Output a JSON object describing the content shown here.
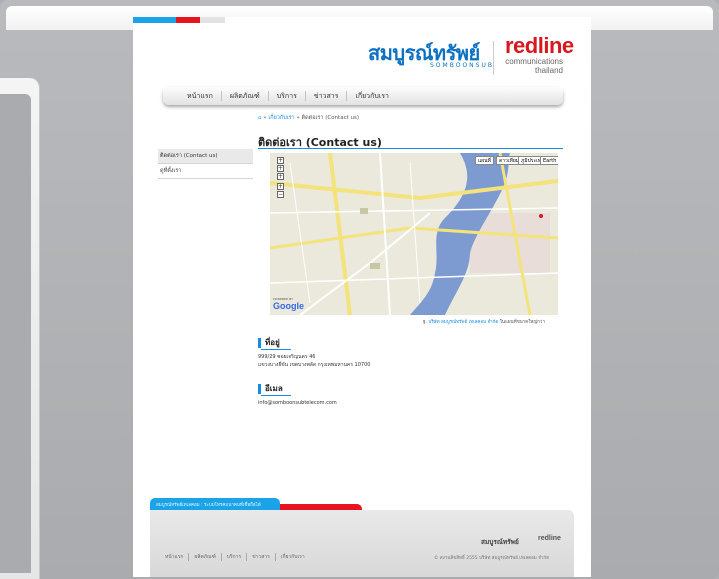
{
  "header": {
    "logo_thai": "สมบูรณ์ทรัพย์",
    "logo_sub": "SOMBOONSUB",
    "logo_redline": "redline",
    "logo_redline_sub1": "communications",
    "logo_redline_sub2": "thailand"
  },
  "nav": {
    "items": [
      {
        "label": "หน้าแรก"
      },
      {
        "label": "ผลิตภัณฑ์"
      },
      {
        "label": "บริการ"
      },
      {
        "label": "ข่าวสาร"
      },
      {
        "label": "เกี่ยวกับเรา"
      }
    ]
  },
  "breadcrumb": {
    "home_icon": "home-icon",
    "sep": "»",
    "about": "เกี่ยวกับเรา",
    "current": "ติดต่อเรา (Contact us)"
  },
  "page": {
    "title": "ติดต่อเรา (Contact us)"
  },
  "sidebar": {
    "items": [
      {
        "label": "ติดต่อเรา (Contact us)"
      },
      {
        "label": "ดูที่ตั้งเรา"
      }
    ]
  },
  "map": {
    "buttons": [
      "แผนที่",
      "ดาวเทียม",
      "ภูมิประเทศ",
      "Earth"
    ],
    "zoom_in": "+",
    "zoom_out": "−",
    "google": "Google",
    "powered": "POWERED BY",
    "caption_prefix": "ฐ.",
    "caption_link": "บริษัท สมบูรณ์ทรัพย์ เทเลคอม จำกัด",
    "caption_suffix": "ในแผนที่ขนาดใหญ่กว่า"
  },
  "address": {
    "heading": "ที่อยู่",
    "line1": "999/29 ซอยเจริญนคร 46",
    "line2": "แขวงบางยี่ขัน เขตบางพลัด กรุงเทพมหานคร 10700"
  },
  "email": {
    "heading": "อีเมล",
    "value": "info@somboonsubtelecom.com"
  },
  "footer": {
    "tab_text": "สมบูรณ์ทรัพย์เทเลคอม : ระบบโทรคมนาคมที่เชื่อถือได้",
    "links": [
      "หน้าแรก",
      "ผลิตภัณฑ์",
      "บริการ",
      "ข่าวสาร",
      "เกี่ยวกับเรา"
    ],
    "logo_thai": "สมบูรณ์ทรัพย์",
    "logo_red": "redline",
    "copyright": "© สงวนลิขสิทธิ์ 2555 บริษัท สมบูรณ์ทรัพย์ เทเลคอม จำกัด"
  },
  "colors": {
    "accent_blue": "#1a8be0",
    "accent_red": "#e8141d"
  }
}
